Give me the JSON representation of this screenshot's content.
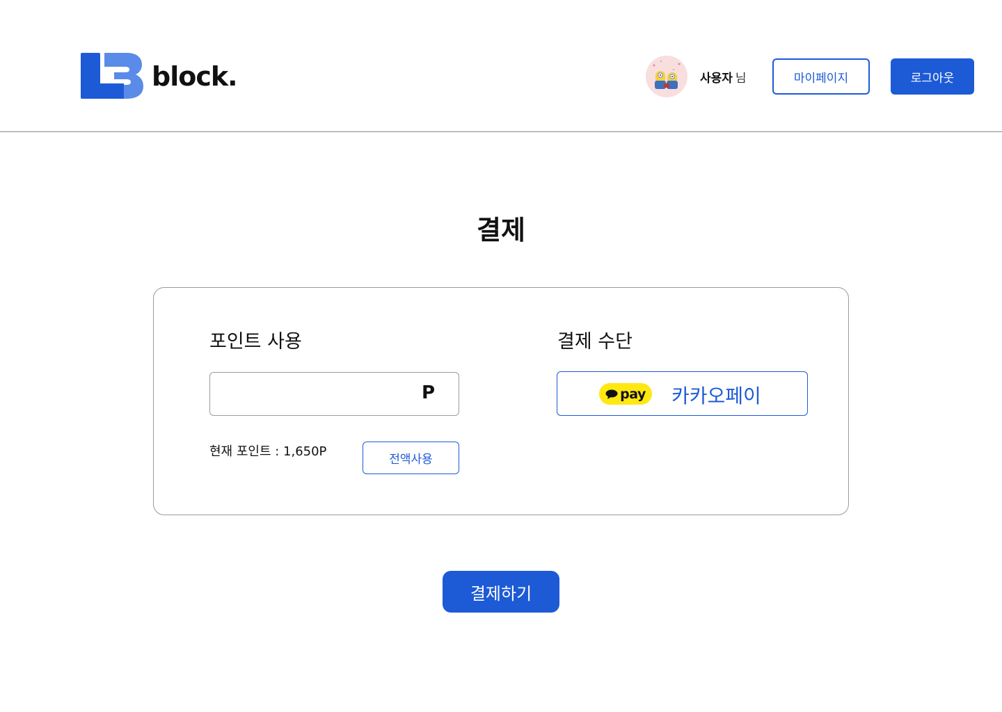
{
  "header": {
    "logo_text": "block.",
    "user": {
      "name": "사용자",
      "suffix": "님",
      "avatar_icon": "minions-avatar"
    },
    "mypage_label": "마이페이지",
    "logout_label": "로그아웃"
  },
  "page": {
    "title": "결제"
  },
  "points": {
    "title": "포인트 사용",
    "input_value": "",
    "unit": "P",
    "current_label": "현재 포인트 : 1,650P",
    "use_all_label": "전액사용"
  },
  "payment_method": {
    "title": "결제 수단",
    "kakao_badge": "pay",
    "kakao_label": "카카오페이"
  },
  "submit_label": "결제하기",
  "colors": {
    "primary": "#1d5ad6",
    "kakao_yellow": "#ffe812",
    "border": "#9a9a9a"
  }
}
